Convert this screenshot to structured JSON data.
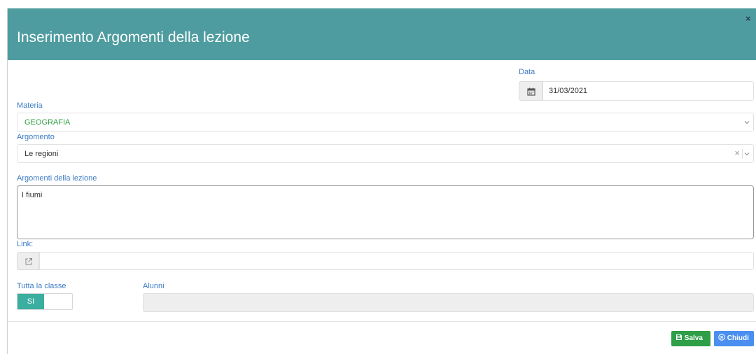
{
  "modal": {
    "title": "Inserimento Argomenti della lezione",
    "close_icon": "close-icon"
  },
  "form": {
    "data": {
      "label": "Data",
      "value": "31/03/2021",
      "icon": "calendar-icon"
    },
    "materia": {
      "label": "Materia",
      "value": "GEOGRAFIA",
      "value_color": "#2ea043",
      "icon": "chevron-down-icon"
    },
    "argomento": {
      "label": "Argomento",
      "value": "Le regioni",
      "clear_icon": "clear-icon",
      "icon": "chevron-down-icon"
    },
    "argomenti_lezione": {
      "label": "Argomenti della lezione",
      "value": "I fiumi"
    },
    "link": {
      "label": "Link:",
      "value": "",
      "icon": "external-link-icon"
    },
    "tutta_la_classe": {
      "label": "Tutta la classe",
      "toggle_label": "SI",
      "on": true
    },
    "alunni": {
      "label": "Alunni",
      "value": ""
    }
  },
  "footer": {
    "save_label": "Salva",
    "close_label": "Chiudi",
    "save_color": "#2e9e47",
    "close_color": "#4a8ef0"
  },
  "colors": {
    "header": "#4e9c9f",
    "label": "#3c7bc4",
    "toggle_on": "#3aafa0"
  }
}
